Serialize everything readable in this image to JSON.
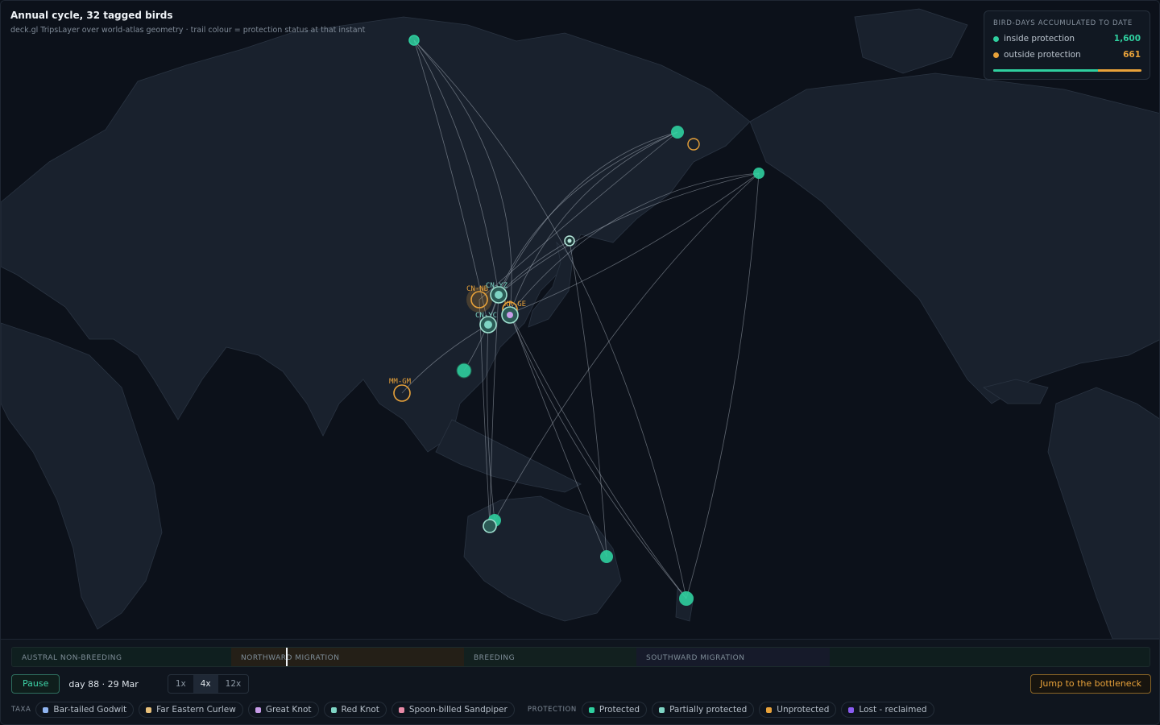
{
  "header": {
    "title": "Annual cycle, 32 tagged birds",
    "subtitle": "deck.gl TripsLayer over world-atlas geometry · trail colour = protection status at that instant"
  },
  "counter": {
    "heading": "BIRD-DAYS ACCUMULATED TO DATE",
    "inside_label": "inside protection",
    "inside_value": "1,600",
    "outside_label": "outside protection",
    "outside_value": "661",
    "inside_fraction": 0.708
  },
  "map": {
    "site_labels": [
      "CN-NB",
      "CN-YZ",
      "CN-YC",
      "KR-GE",
      "MM-GM"
    ]
  },
  "timeline": {
    "segments": [
      "AUSTRAL NON-BREEDING",
      "NORTHWARD MIGRATION",
      "BREEDING",
      "SOUTHWARD MIGRATION"
    ],
    "current_day_of_year": 88
  },
  "controls": {
    "pause_label": "Pause",
    "day_label": "day 88 · 29 Mar",
    "speeds": [
      "1x",
      "4x",
      "12x"
    ],
    "active_speed": "4x",
    "jump_label": "Jump to the bottleneck"
  },
  "legend": {
    "taxa_heading": "TAXA",
    "taxa": [
      {
        "label": "Bar-tailed Godwit",
        "color": "#8fb4f0"
      },
      {
        "label": "Far Eastern Curlew",
        "color": "#e8c07a"
      },
      {
        "label": "Great Knot",
        "color": "#c79ce8"
      },
      {
        "label": "Red Knot",
        "color": "#7fd4c4"
      },
      {
        "label": "Spoon-billed Sandpiper",
        "color": "#e88aa6"
      }
    ],
    "protection_heading": "PROTECTION",
    "protection": [
      {
        "label": "Protected",
        "color": "#2fcf9f"
      },
      {
        "label": "Partially protected",
        "color": "#7fd4c4"
      },
      {
        "label": "Unprotected",
        "color": "#e8a23a"
      },
      {
        "label": "Lost - reclaimed",
        "color": "#8a5cf0"
      }
    ]
  }
}
